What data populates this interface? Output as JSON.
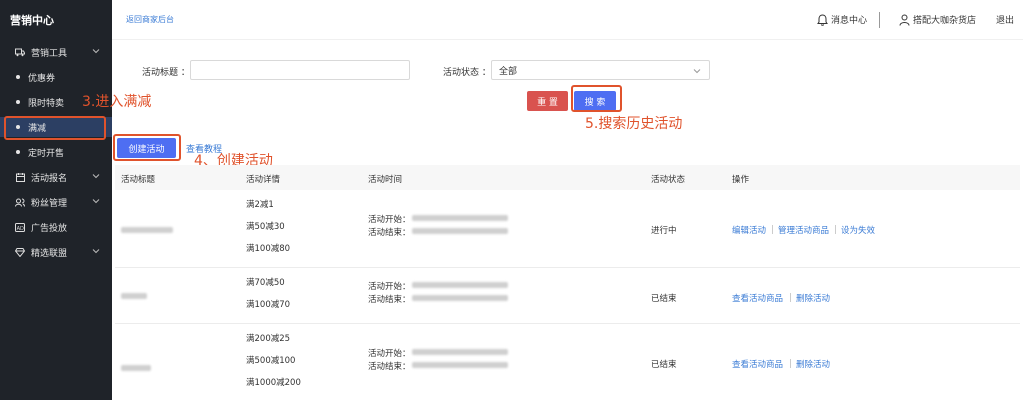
{
  "sidebar": {
    "brand": "营销中心",
    "groups": [
      {
        "label": "营销工具",
        "icon": "truck-icon"
      },
      {
        "label": "活动报名",
        "icon": "calendar-icon"
      },
      {
        "label": "粉丝管理",
        "icon": "fans-icon"
      },
      {
        "label": "广告投放",
        "icon": "ad-icon"
      },
      {
        "label": "精选联盟",
        "icon": "diamond-icon"
      }
    ],
    "items": [
      {
        "label": "优惠券"
      },
      {
        "label": "限时特卖"
      },
      {
        "label": "满减"
      },
      {
        "label": "定时开售"
      }
    ]
  },
  "header": {
    "back_link": "返回商家后台",
    "messages": "消息中心",
    "store": "搭配大咖杂货店",
    "logout": "退出"
  },
  "filter": {
    "title_label": "活动标题 ：",
    "title_value": "",
    "status_label": "活动状态 ：",
    "status_value": "全部",
    "reset_label": "重 置",
    "search_label": "搜 索"
  },
  "actions": {
    "create_label": "创建活动",
    "tutorial_label": "查看教程"
  },
  "annotations": {
    "step3": "3.进入满减",
    "step4": "4、创建活动",
    "step5": "5.搜索历史活动",
    "color": "#e0532c"
  },
  "table": {
    "columns": [
      "活动标题",
      "活动详情",
      "活动时间",
      "活动状态",
      "操作"
    ],
    "start_label": "活动开始：",
    "end_label": "活动结束：",
    "rows": [
      {
        "details": [
          "满2减1",
          "满50减30",
          "满100减80"
        ],
        "status": "进行中",
        "ops": [
          "编辑活动",
          "管理活动商品",
          "设为失效"
        ]
      },
      {
        "details": [
          "满70减50",
          "满100减70"
        ],
        "status": "已结束",
        "ops": [
          "查看活动商品",
          "删除活动"
        ]
      },
      {
        "details": [
          "满200减25",
          "满500减100",
          "满1000减200"
        ],
        "status": "已结束",
        "ops": [
          "查看活动商品",
          "删除活动"
        ]
      }
    ]
  },
  "colors": {
    "sidebar_bg": "#1f2329",
    "primary": "#4e6ef2",
    "danger": "#d9534f",
    "link": "#3a7bd5"
  }
}
